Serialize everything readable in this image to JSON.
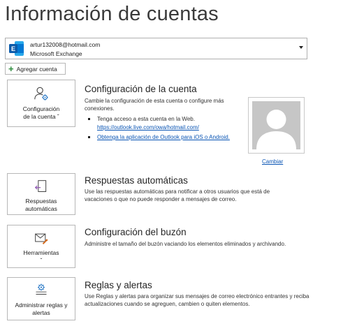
{
  "page": {
    "title": "Información de cuentas"
  },
  "account": {
    "email": "artur132008@hotmail.com",
    "type": "Microsoft Exchange",
    "logo_icon": "exchange-logo-icon",
    "accent": "#0f6cbd"
  },
  "add_account": {
    "label": "Agregar cuenta",
    "icon": "plus-icon"
  },
  "sections": {
    "account_settings": {
      "tile_label_line1": "Configuración",
      "tile_label_line2": "de la cuenta ˇ",
      "icon": "user-gear-icon",
      "title": "Configuración de la cuenta",
      "description": "Cambie la configuración de esta cuenta o configure más conexiones.",
      "bullet1": "Tenga acceso a esta cuenta en la Web.",
      "bullet1_link": "https://outlook.live.com/owa/hotmail.com/",
      "bullet2_link": "Obtenga la aplicación de Outlook para iOS o Android.",
      "change_photo": "Cambiar",
      "photo_icon": "profile-placeholder-icon"
    },
    "auto_replies": {
      "tile_label_line1": "Respuestas",
      "tile_label_line2": "automáticas",
      "icon": "door-arrow-icon",
      "title": "Respuestas automáticas",
      "description": "Use las respuestas automáticas para notificar a otros usuarios que está de vacaciones o que no puede responder a mensajes de correo."
    },
    "mailbox_settings": {
      "tile_label_line1": "Herramientas",
      "tile_label_line2": "ˇ",
      "icon": "mailbox-tools-icon",
      "title": "Configuración del buzón",
      "description": "Administre el tamaño del buzón vaciando los elementos eliminados y archivando."
    },
    "rules_alerts": {
      "tile_label_line1": "Administrar reglas y",
      "tile_label_line2": "alertas",
      "icon": "rules-gear-icon",
      "title": "Reglas y alertas",
      "description": "Use Reglas y alertas para organizar sus mensajes de correo electrónico entrantes y reciba actualizaciones cuando se agreguen, cambien o quiten elementos."
    }
  }
}
